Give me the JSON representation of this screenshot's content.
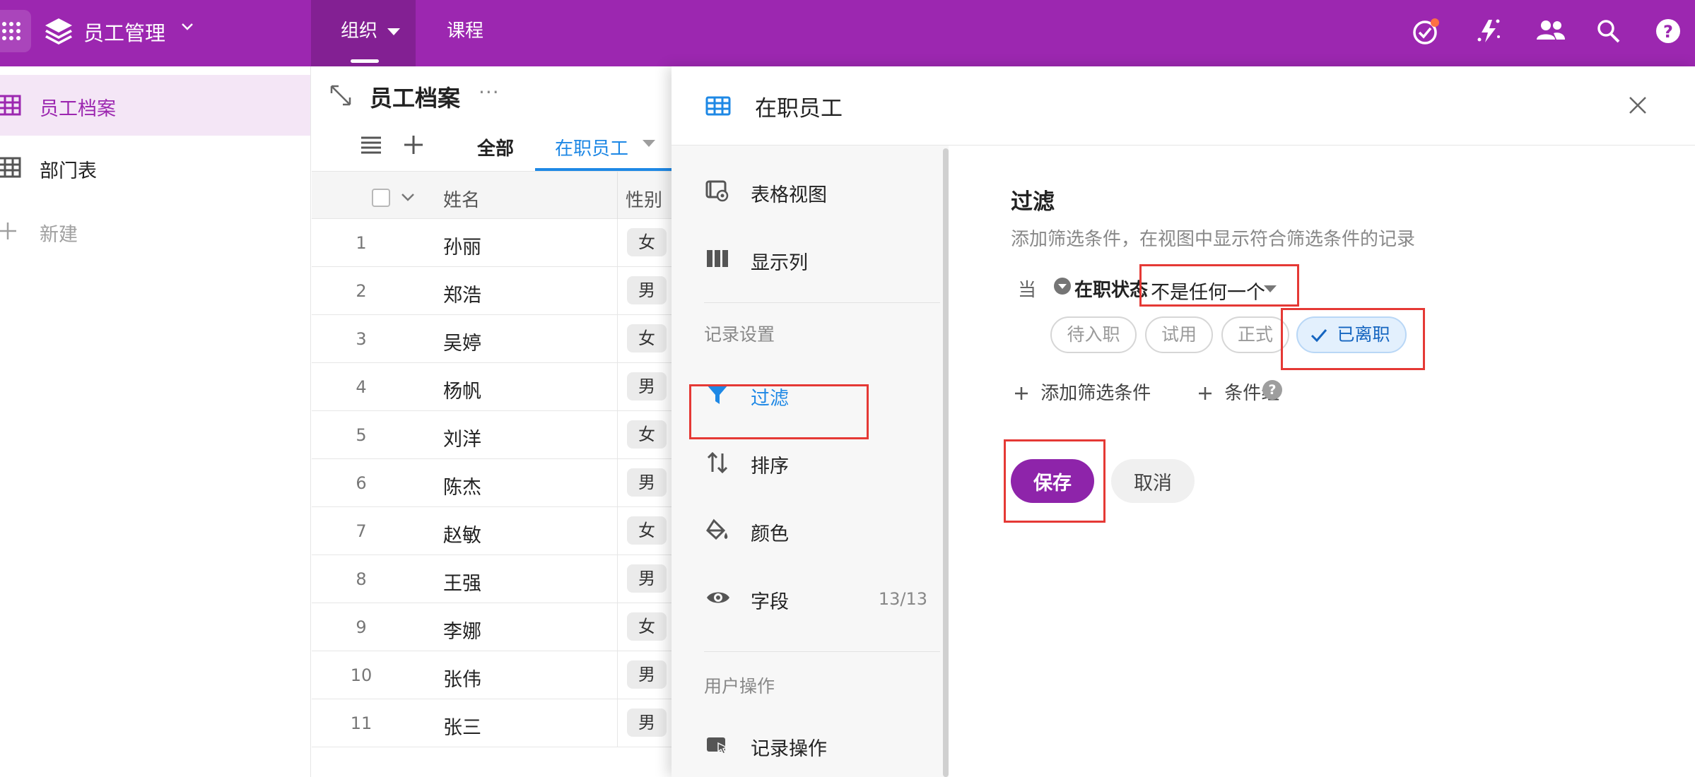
{
  "topbar": {
    "app_name": "员工管理",
    "nav_tabs": [
      {
        "label": "组织"
      },
      {
        "label": "课程"
      }
    ],
    "icons": [
      "apps-grid-icon",
      "app-logo-icon",
      "tasks-check-icon",
      "automation-bolt-icon",
      "team-icon",
      "search-icon",
      "help-icon"
    ],
    "brand_color": "#9c27b0"
  },
  "sidebar": {
    "items": [
      {
        "label": "员工档案"
      },
      {
        "label": "部门表"
      }
    ],
    "new_label": "新建"
  },
  "table": {
    "title": "员工档案",
    "more": "···",
    "view_tabs": [
      {
        "label": "全部"
      },
      {
        "label": "在职员工"
      }
    ],
    "columns": [
      "姓名",
      "性别"
    ],
    "rows": [
      {
        "num": "1",
        "name": "孙丽",
        "gender": "女"
      },
      {
        "num": "2",
        "name": "郑浩",
        "gender": "男"
      },
      {
        "num": "3",
        "name": "吴婷",
        "gender": "女"
      },
      {
        "num": "4",
        "name": "杨帆",
        "gender": "男"
      },
      {
        "num": "5",
        "name": "刘洋",
        "gender": "女"
      },
      {
        "num": "6",
        "name": "陈杰",
        "gender": "男"
      },
      {
        "num": "7",
        "name": "赵敏",
        "gender": "女"
      },
      {
        "num": "8",
        "name": "王强",
        "gender": "男"
      },
      {
        "num": "9",
        "name": "李娜",
        "gender": "女"
      },
      {
        "num": "10",
        "name": "张伟",
        "gender": "男"
      },
      {
        "num": "11",
        "name": "张三",
        "gender": "男"
      }
    ]
  },
  "dialog": {
    "title": "在职员工",
    "nav": {
      "items_top": [
        {
          "label": "表格视图",
          "icon": "table-view-icon"
        },
        {
          "label": "显示列",
          "icon": "columns-icon"
        }
      ],
      "section_record": "记录设置",
      "items_record": [
        {
          "label": "过滤",
          "icon": "filter-icon"
        },
        {
          "label": "排序",
          "icon": "sort-icon"
        },
        {
          "label": "颜色",
          "icon": "paint-bucket-icon"
        },
        {
          "label": "字段",
          "icon": "eye-icon",
          "count": "13/13"
        }
      ],
      "section_user": "用户操作",
      "items_user": [
        {
          "label": "记录操作",
          "icon": "record-action-icon"
        }
      ]
    },
    "filter": {
      "title": "过滤",
      "description": "添加筛选条件，在视图中显示符合筛选条件的记录",
      "when": "当",
      "field": "在职状态",
      "operator": "不是任何一个",
      "options": [
        {
          "label": "待入职",
          "selected": false
        },
        {
          "label": "试用",
          "selected": false
        },
        {
          "label": "正式",
          "selected": false
        },
        {
          "label": "已离职",
          "selected": true
        }
      ],
      "add_condition": "添加筛选条件",
      "add_group": "条件组",
      "help": "?",
      "save": "保存",
      "cancel": "取消"
    }
  },
  "highlight_color": "#e53935",
  "link_color": "#1e88e5"
}
